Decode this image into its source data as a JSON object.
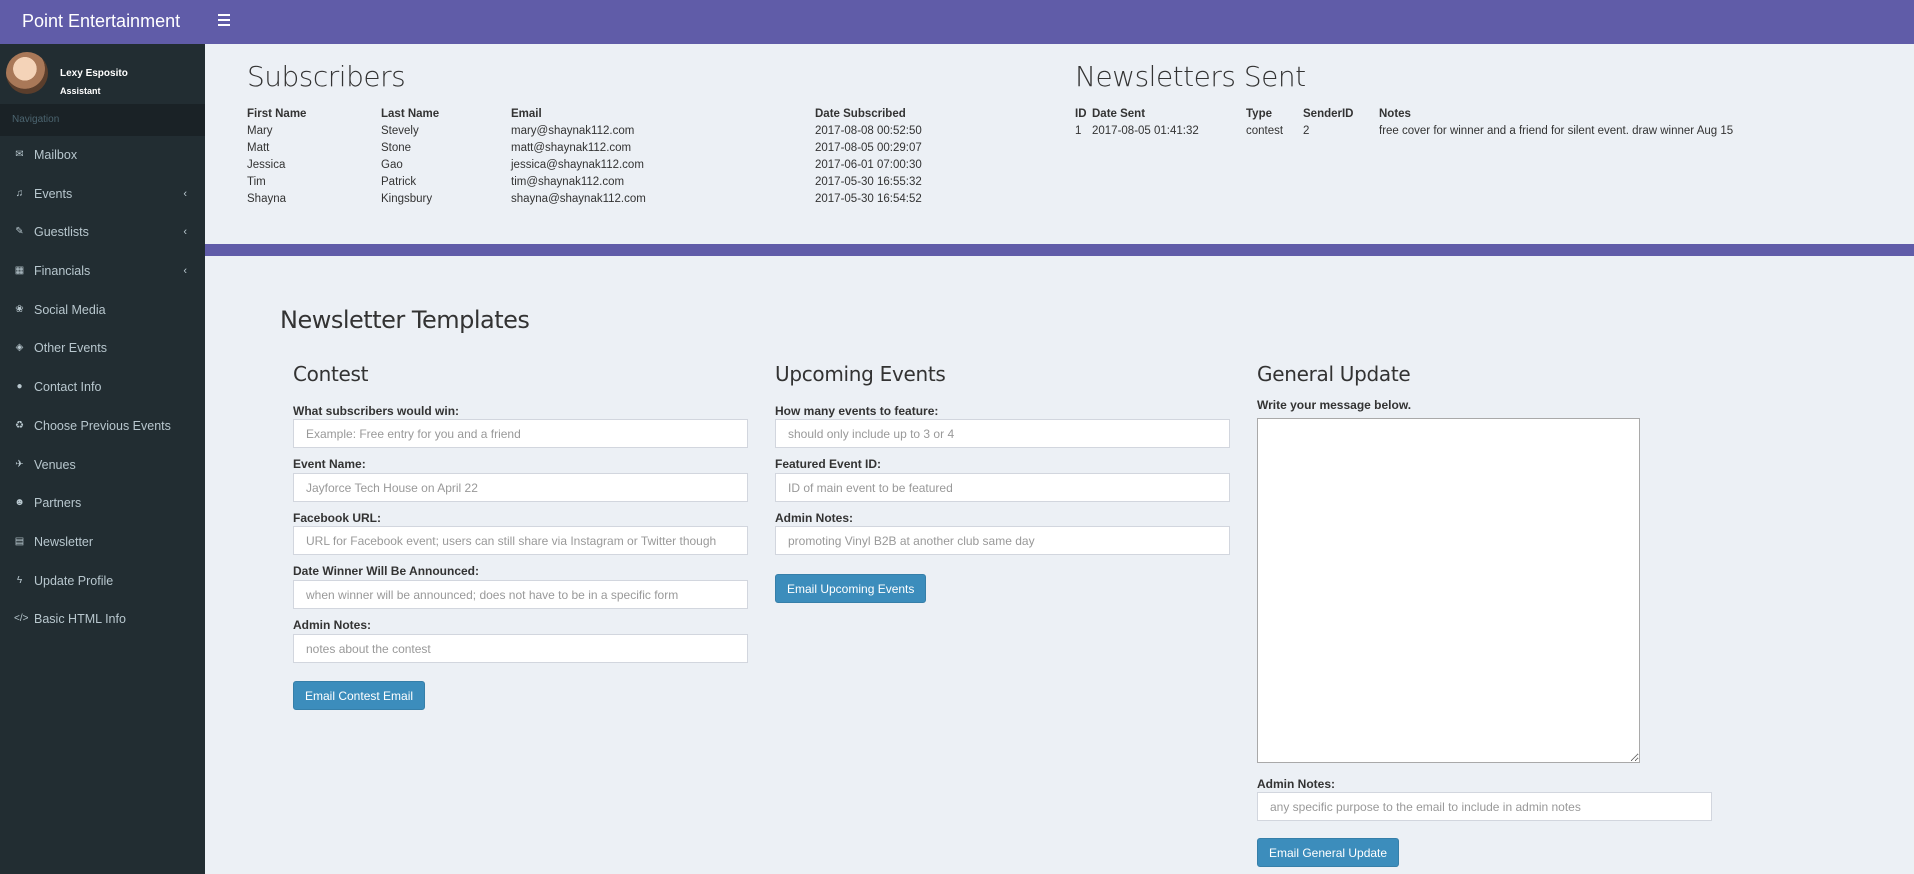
{
  "app": {
    "brand": "Point Entertainment"
  },
  "user": {
    "name": "Lexy Esposito",
    "role": "Assistant"
  },
  "sidebar": {
    "header": "Navigation",
    "items": [
      {
        "label": "Mailbox",
        "icon": "envelope-icon",
        "glyph": "✉",
        "has_children": false
      },
      {
        "label": "Events",
        "icon": "music-icon",
        "glyph": "♫",
        "has_children": true
      },
      {
        "label": "Guestlists",
        "icon": "pencil-icon",
        "glyph": "✎",
        "has_children": true
      },
      {
        "label": "Financials",
        "icon": "calculator-icon",
        "glyph": "▦",
        "has_children": true
      },
      {
        "label": "Social Media",
        "icon": "paw-icon",
        "glyph": "❀",
        "has_children": false
      },
      {
        "label": "Other Events",
        "icon": "tag-icon",
        "glyph": "◈",
        "has_children": false
      },
      {
        "label": "Contact Info",
        "icon": "user-icon",
        "glyph": "●",
        "has_children": false
      },
      {
        "label": "Choose Previous Events",
        "icon": "recycle-icon",
        "glyph": "♻",
        "has_children": false
      },
      {
        "label": "Venues",
        "icon": "plane-icon",
        "glyph": "✈",
        "has_children": false
      },
      {
        "label": "Partners",
        "icon": "users-icon",
        "glyph": "☻",
        "has_children": false
      },
      {
        "label": "Newsletter",
        "icon": "newspaper-icon",
        "glyph": "▤",
        "has_children": false
      },
      {
        "label": "Update Profile",
        "icon": "bolt-icon",
        "glyph": "ϟ",
        "has_children": false
      },
      {
        "label": "Basic HTML Info",
        "icon": "code-icon",
        "glyph": "</>",
        "has_children": false
      }
    ],
    "chevron": "‹"
  },
  "subscribers": {
    "title": "Subscribers",
    "headers": [
      "First Name",
      "Last Name",
      "Email",
      "Date Subscribed"
    ],
    "rows": [
      [
        "Mary",
        "Stevely",
        "mary@shaynak112.com",
        "2017-08-08 00:52:50"
      ],
      [
        "Matt",
        "Stone",
        "matt@shaynak112.com",
        "2017-08-05 00:29:07"
      ],
      [
        "Jessica",
        "Gao",
        "jessica@shaynak112.com",
        "2017-06-01 07:00:30"
      ],
      [
        "Tim",
        "Patrick",
        "tim@shaynak112.com",
        "2017-05-30 16:55:32"
      ],
      [
        "Shayna",
        "Kingsbury",
        "shayna@shaynak112.com",
        "2017-05-30 16:54:52"
      ]
    ]
  },
  "newsletters_sent": {
    "title": "Newsletters Sent",
    "headers": [
      "ID",
      "Date Sent",
      "Type",
      "SenderID",
      "Notes"
    ],
    "rows": [
      [
        "1",
        "2017-08-05 01:41:32",
        "contest",
        "2",
        "free cover for winner and a friend for silent event. draw winner Aug 15"
      ]
    ]
  },
  "templates": {
    "title": "Newsletter Templates",
    "contest": {
      "title": "Contest",
      "win_label": "What subscribers would win:",
      "win_placeholder": "Example: Free entry for you and a friend",
      "event_label": "Event Name:",
      "event_placeholder": "Jayforce Tech House on April 22",
      "facebook_label": "Facebook URL:",
      "facebook_placeholder": "URL for Facebook event; users can still share via Instagram or Twitter though",
      "date_label": "Date Winner Will Be Announced:",
      "date_placeholder": "when winner will be announced; does not have to be in a specific form",
      "notes_label": "Admin Notes:",
      "notes_placeholder": "notes about the contest",
      "button": "Email Contest Email"
    },
    "upcoming": {
      "title": "Upcoming Events",
      "count_label": "How many events to feature:",
      "count_placeholder": "should only include up to 3 or 4",
      "featured_label": "Featured Event ID:",
      "featured_placeholder": "ID of main event to be featured",
      "notes_label": "Admin Notes:",
      "notes_placeholder": "promoting Vinyl B2B at another club same day",
      "button": "Email Upcoming Events"
    },
    "general": {
      "title": "General Update",
      "message_label": "Write your message below.",
      "notes_label": "Admin Notes:",
      "notes_placeholder": "any specific purpose to the email to include in admin notes",
      "button": "Email General Update"
    }
  },
  "colors": {
    "header": "#605ca8",
    "sidebar": "#222d32",
    "button": "#3c8dbc",
    "content_bg": "#ecf0f5"
  }
}
